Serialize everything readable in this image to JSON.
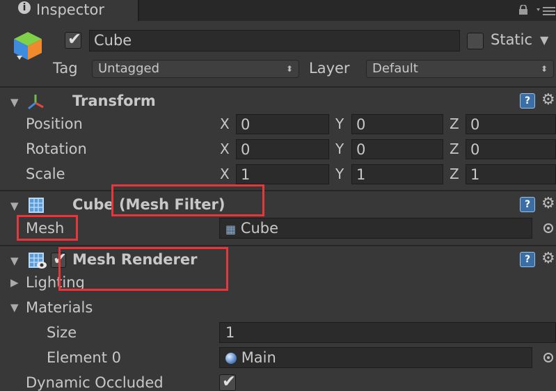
{
  "window": {
    "tab_title": "Inspector",
    "tab_icon": "info-icon"
  },
  "gameobject": {
    "name": "Cube",
    "active": true,
    "static_label": "Static",
    "static_checked": false,
    "tag_label": "Tag",
    "tag_value": "Untagged",
    "layer_label": "Layer",
    "layer_value": "Default"
  },
  "transform": {
    "title": "Transform",
    "rows": [
      {
        "label": "Position",
        "x": "0",
        "y": "0",
        "z": "0"
      },
      {
        "label": "Rotation",
        "x": "0",
        "y": "0",
        "z": "0"
      },
      {
        "label": "Scale",
        "x": "1",
        "y": "1",
        "z": "1"
      }
    ],
    "axis": {
      "x": "X",
      "y": "Y",
      "z": "Z"
    }
  },
  "mesh_filter": {
    "title": "Cube (Mesh Filter)",
    "mesh_label": "Mesh",
    "mesh_value": "Cube"
  },
  "mesh_renderer": {
    "title": "Mesh Renderer",
    "enabled": true,
    "lighting_label": "Lighting",
    "materials_label": "Materials",
    "size_label": "Size",
    "size_value": "1",
    "element0_label": "Element 0",
    "element0_value": "Main",
    "dynamic_occluded_label": "Dynamic Occluded",
    "dynamic_occluded": true
  },
  "help_glyph": "?",
  "colors": {
    "highlight": "#e8363c",
    "background": "#383838",
    "field": "#2b2b2b"
  }
}
